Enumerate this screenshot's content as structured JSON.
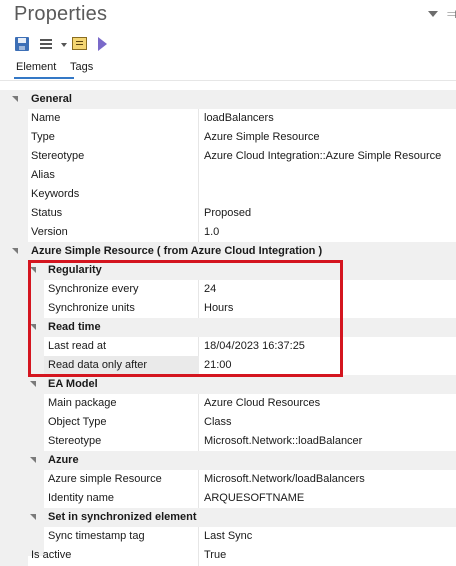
{
  "panel": {
    "title": "Properties"
  },
  "tabs": [
    {
      "label": "Element"
    },
    {
      "label": "Tags"
    }
  ],
  "general": {
    "header": "General",
    "rows": [
      {
        "name": "Name",
        "value": "loadBalancers"
      },
      {
        "name": "Type",
        "value": "Azure Simple Resource"
      },
      {
        "name": "Stereotype",
        "value": "Azure Cloud Integration::Azure Simple Resource"
      },
      {
        "name": "Alias",
        "value": ""
      },
      {
        "name": "Keywords",
        "value": ""
      },
      {
        "name": "Status",
        "value": "Proposed"
      },
      {
        "name": "Version",
        "value": "1.0"
      }
    ]
  },
  "azure_simple_resource": {
    "header": "Azure Simple Resource  ( from Azure Cloud Integration )",
    "regularity": {
      "header": "Regularity",
      "rows": [
        {
          "name": "Synchronize every",
          "value": "24"
        },
        {
          "name": "Synchronize units",
          "value": "Hours"
        }
      ]
    },
    "read_time": {
      "header": "Read time",
      "rows": [
        {
          "name": "Last read at",
          "value": "18/04/2023 16:37:25"
        },
        {
          "name": "Read data only after",
          "value": "21:00"
        }
      ]
    },
    "ea_model": {
      "header": "EA Model",
      "rows": [
        {
          "name": "Main package",
          "value": "Azure Cloud Resources"
        },
        {
          "name": "Object Type",
          "value": "Class"
        },
        {
          "name": "Stereotype",
          "value": "Microsoft.Network::loadBalancer"
        }
      ]
    },
    "azure": {
      "header": "Azure",
      "rows": [
        {
          "name": "Azure simple Resource",
          "value": "Microsoft.Network/loadBalancers"
        },
        {
          "name": "Identity name",
          "value": "ARQUESOFTNAME"
        }
      ]
    },
    "sync_element": {
      "header": "Set in synchronized element",
      "rows": [
        {
          "name": "Sync timestamp tag",
          "value": "Last Sync"
        }
      ]
    }
  },
  "is_active": {
    "name": "Is active",
    "value": "True"
  },
  "colors": {
    "highlight_box": "#d4151f",
    "tab_underline": "#3478c6",
    "section_bg": "#f0f0f0"
  }
}
